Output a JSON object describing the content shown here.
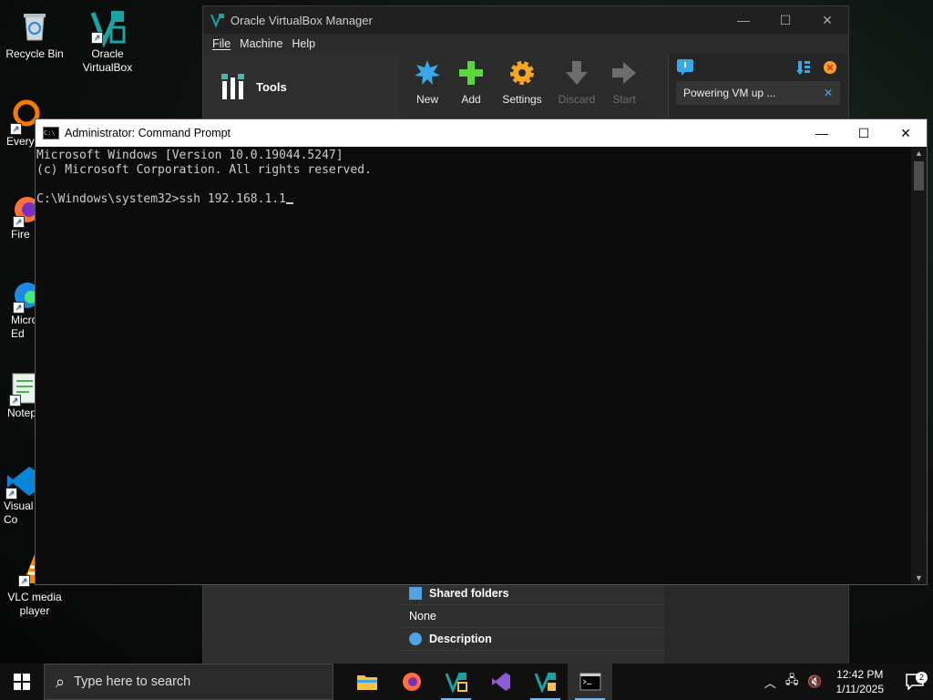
{
  "desktop": {
    "icons": [
      {
        "label": "Recycle Bin"
      },
      {
        "label": "Oracle VirtualBox"
      },
      {
        "label": "Every"
      },
      {
        "label": "Fire"
      },
      {
        "label": "Micro Ed"
      },
      {
        "label": "Notep"
      },
      {
        "label": "Visual Co"
      },
      {
        "label": "VLC media player"
      }
    ]
  },
  "virtualbox": {
    "title": "Oracle VirtualBox Manager",
    "menu": [
      "File",
      "Machine",
      "Help"
    ],
    "tools_label": "Tools",
    "toolbar": [
      {
        "label": "New",
        "icon": "new-starburst-icon",
        "enabled": true
      },
      {
        "label": "Add",
        "icon": "add-plus-icon",
        "enabled": true
      },
      {
        "label": "Settings",
        "icon": "gear-icon",
        "enabled": true
      },
      {
        "label": "Discard",
        "icon": "discard-arrow-down-icon",
        "enabled": false
      },
      {
        "label": "Start",
        "icon": "start-arrow-right-icon",
        "enabled": false
      }
    ],
    "notification": "Powering VM up ...",
    "details": {
      "shared_folders_label": "Shared folders",
      "shared_folders_value": "None",
      "description_label": "Description"
    },
    "colors": {
      "accent": "#4fb3b0"
    }
  },
  "cmd": {
    "title": "Administrator: Command Prompt",
    "lines": [
      "Microsoft Windows [Version 10.0.19044.5247]",
      "(c) Microsoft Corporation. All rights reserved.",
      "",
      "C:\\Windows\\system32>ssh 192.168.1.1"
    ]
  },
  "taskbar": {
    "search_placeholder": "Type here to search",
    "apps": [
      {
        "name": "file-explorer-icon",
        "running": false
      },
      {
        "name": "firefox-icon",
        "running": false
      },
      {
        "name": "virtualbox-icon",
        "running": true
      },
      {
        "name": "visual-studio-icon",
        "running": false
      },
      {
        "name": "virtualbox-vm-icon",
        "running": true
      },
      {
        "name": "command-prompt-icon",
        "running": true,
        "active": true
      }
    ],
    "time": "12:42 PM",
    "date": "1/11/2025",
    "notification_count": "2"
  }
}
